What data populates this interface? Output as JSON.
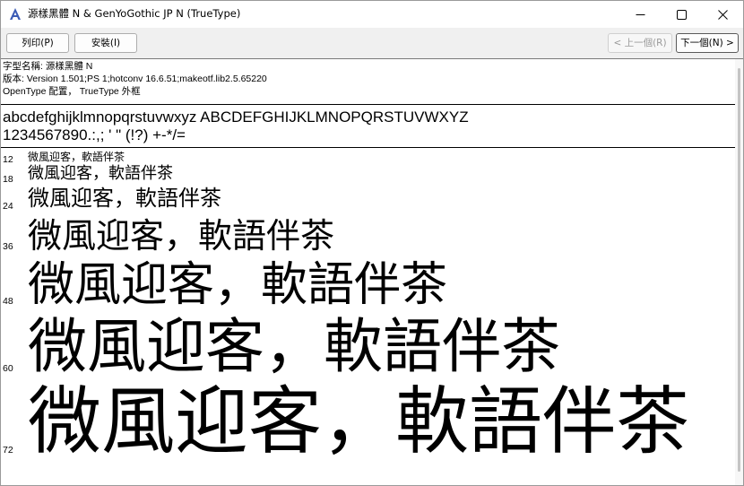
{
  "window": {
    "title": "源樣黑體 N & GenYoGothic JP N  (TrueType)",
    "icon": "font-file-icon"
  },
  "toolbar": {
    "print_label": "列印(P)",
    "install_label": "安裝(I)",
    "prev_label": "< 上一個(R)",
    "next_label": "下一個(N) >"
  },
  "font_info": {
    "name_line": "字型名稱: 源樣黑體 N",
    "version_line": "版本: Version 1.501;PS 1;hotconv 16.6.51;makeotf.lib2.5.65220",
    "type_line": "OpenType 配置， TrueType 外框"
  },
  "charset": {
    "alphabet": "abcdefghijklmnopqrstuvwxyz ABCDEFGHIJKLMNOPQRSTUVWXYZ",
    "numbers": "1234567890.:,; ' \" (!?) +-*/="
  },
  "samples": [
    {
      "size": "12",
      "text": "微風迎客，軟語伴茶"
    },
    {
      "size": "18",
      "text": "微風迎客，軟語伴茶"
    },
    {
      "size": "24",
      "text": "微風迎客，軟語伴茶"
    },
    {
      "size": "36",
      "text": "微風迎客，軟語伴茶"
    },
    {
      "size": "48",
      "text": "微風迎客，軟語伴茶"
    },
    {
      "size": "60",
      "text": "微風迎客，軟語伴茶"
    },
    {
      "size": "72",
      "text": "微風迎客，軟語伴茶"
    }
  ]
}
